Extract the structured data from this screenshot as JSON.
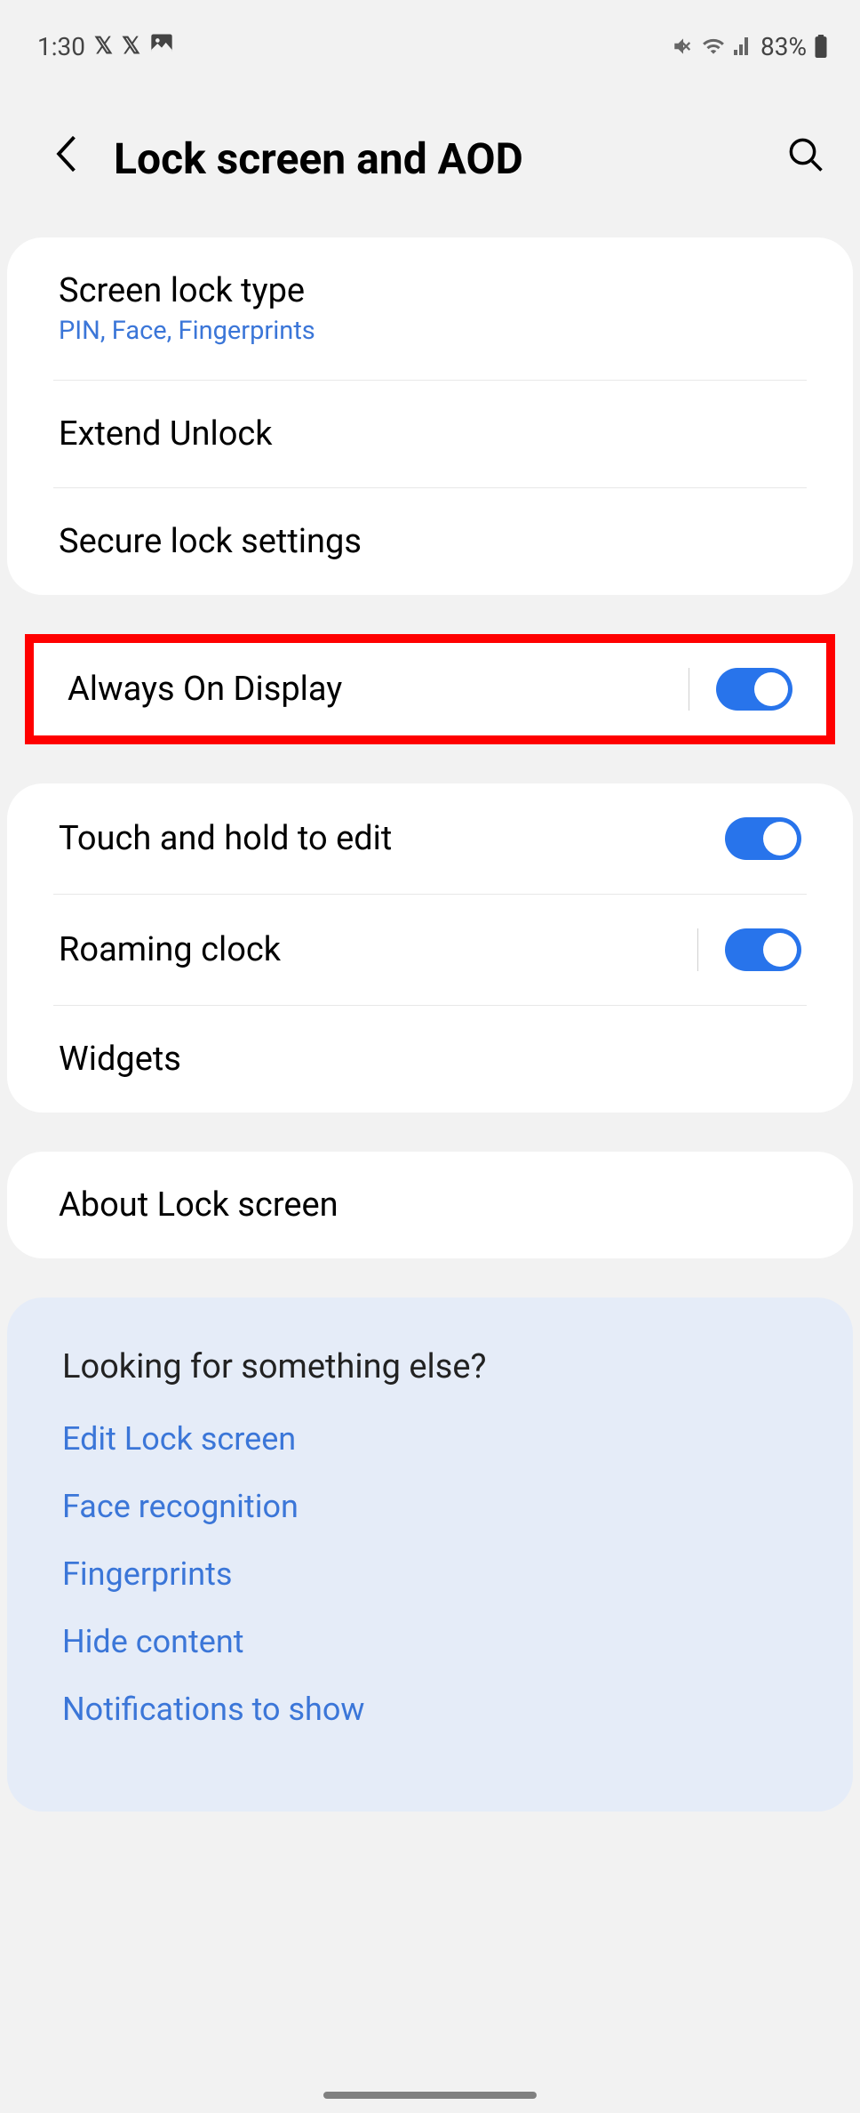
{
  "status_bar": {
    "time": "1:30",
    "battery": "83%"
  },
  "header": {
    "title": "Lock screen and AOD"
  },
  "group1": {
    "screen_lock": {
      "title": "Screen lock type",
      "subtitle": "PIN, Face, Fingerprints"
    },
    "extend_unlock": "Extend Unlock",
    "secure_lock": "Secure lock settings"
  },
  "aod": {
    "title": "Always On Display",
    "enabled": true
  },
  "group3": {
    "touch_hold": {
      "title": "Touch and hold to edit",
      "enabled": true
    },
    "roaming_clock": {
      "title": "Roaming clock",
      "enabled": true
    },
    "widgets": "Widgets"
  },
  "about": "About Lock screen",
  "suggestions": {
    "title": "Looking for something else?",
    "links": [
      "Edit Lock screen",
      "Face recognition",
      "Fingerprints",
      "Hide content",
      "Notifications to show"
    ]
  }
}
